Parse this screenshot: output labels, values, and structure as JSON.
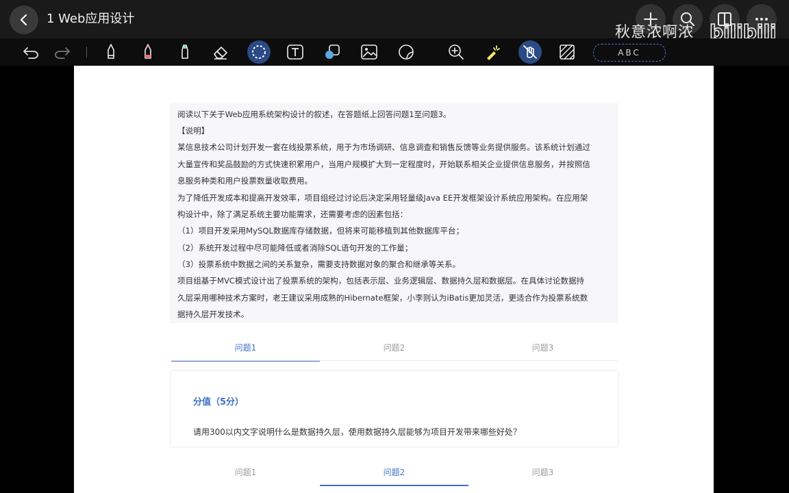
{
  "header": {
    "title": "1 Web应用设计",
    "watermark": "秋意浓啊浓",
    "brand_text": "bilibili"
  },
  "toolbar": {
    "tools": [
      "undo-icon",
      "redo-icon",
      "pen-icon",
      "pencil-icon",
      "marker-icon",
      "eraser-icon",
      "lasso-icon",
      "text-box-icon",
      "shape-icon",
      "image-icon",
      "sticker-icon",
      "zoom-icon",
      "laser-pointer-icon",
      "hand-draw-icon",
      "hatch-pattern-icon"
    ],
    "handwriting_label": "ABC"
  },
  "description": {
    "lines": [
      "阅读以下关于Web应用系统架构设计的叙述，在答题纸上回答问题1至问题3。",
      "【说明】",
      "某信息技术公司计划开发一套在线投票系统，用于为市场调研、信息调查和销售反馈等业务提供服务。该系统计划通过",
      "大量宣传和奖品鼓励的方式快速积累用户，当用户规模扩大到一定程度时，开始联系相关企业提供信息服务，并按照信",
      "息服务种类和用户投票数量收取费用。",
      "为了降低开发成本和提高开发效率，项目组经过讨论后决定采用轻量级Java EE开发框架设计系统应用架构。在应用架",
      "构设计中，除了满足系统主要功能需求，还需要考虑的因素包括：",
      "（1）项目开发采用MySQL数据库存储数据，但将来可能移植到其他数据库平台；",
      "（2）系统开发过程中尽可能降低或者消除SQL语句开发的工作量；",
      "（3）投票系统中数据之间的关系复杂，需要支持数据对象的聚合和继承等关系。",
      "项目组基于MVC模式设计出了投票系统的架构，包括表示层、业务逻辑层、数据持久层和数据层。在具体讨论数据持",
      "久层采用哪种技术方案时，老王建议采用成熟的Hibernate框架，小李则认为iBatis更加灵活，更适合作为投票系统数",
      "据持久层开发技术。"
    ]
  },
  "tabs_top": {
    "items": [
      "问题1",
      "问题2",
      "问题3"
    ],
    "active": 0
  },
  "question": {
    "score": "分值（5分）",
    "text": "请用300以内文字说明什么是数据持久层，使用数据持久层能够为项目开发带来哪些好处？"
  },
  "tabs_bottom": {
    "items": [
      "问题1",
      "问题2",
      "问题3"
    ],
    "active": 1
  },
  "colors": {
    "accent": "#3f6fc4",
    "toolbar_bg": "#0d0d0d",
    "active_tool": "#2b4a86"
  }
}
